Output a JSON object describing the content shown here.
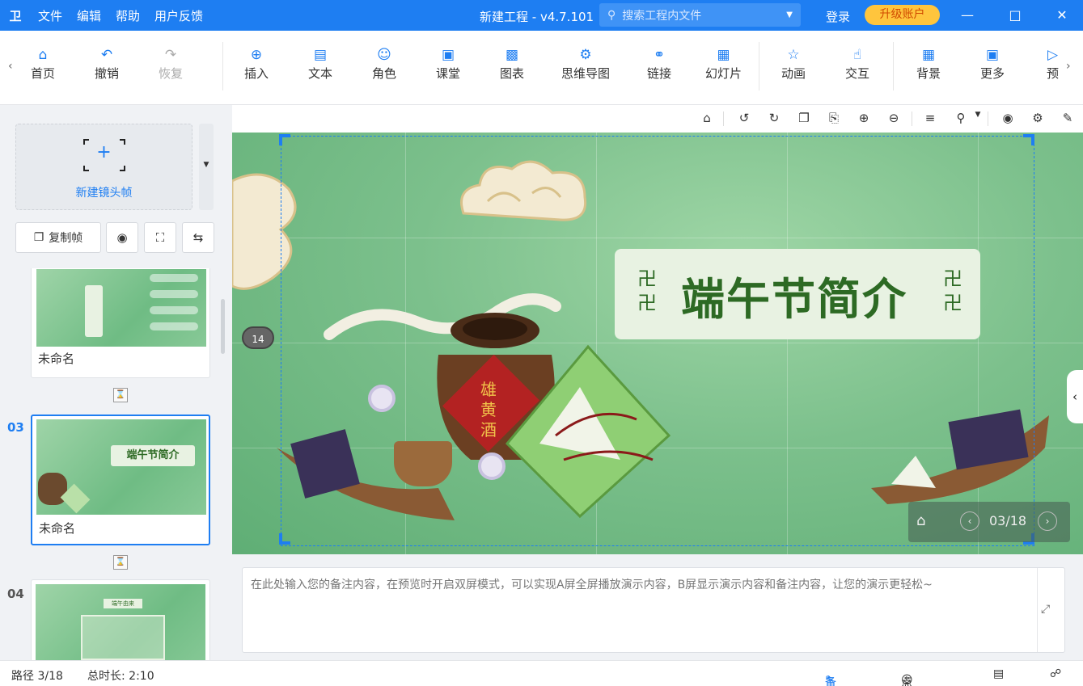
{
  "app": {
    "title": "新建工程 - v4.7.101",
    "logo": "卫",
    "menu": [
      "文件",
      "编辑",
      "帮助",
      "用户反馈"
    ],
    "search_placeholder": "搜索工程内文件",
    "login": "登录",
    "upgrade": "升级账户"
  },
  "toolbar": {
    "items": [
      {
        "label": "首页",
        "icon": "home-icon"
      },
      {
        "label": "撤销",
        "icon": "undo-icon"
      },
      {
        "label": "恢复",
        "icon": "redo-icon"
      },
      {
        "label": "插入",
        "icon": "plus-circle-icon"
      },
      {
        "label": "文本",
        "icon": "text-icon"
      },
      {
        "label": "角色",
        "icon": "person-icon"
      },
      {
        "label": "课堂",
        "icon": "classroom-icon"
      },
      {
        "label": "图表",
        "icon": "chart-icon"
      },
      {
        "label": "思维导图",
        "icon": "mindmap-icon"
      },
      {
        "label": "链接",
        "icon": "link-icon"
      },
      {
        "label": "幻灯片",
        "icon": "slideshow-icon"
      },
      {
        "label": "动画",
        "icon": "star-icon"
      },
      {
        "label": "交互",
        "icon": "pointer-icon"
      },
      {
        "label": "背景",
        "icon": "background-icon"
      },
      {
        "label": "更多",
        "icon": "grid-icon"
      },
      {
        "label": "预",
        "icon": "preview-icon"
      }
    ]
  },
  "left_panel": {
    "new_frame_label": "新建镜头帧",
    "copy_frame_label": "复制帧",
    "slides": [
      {
        "number": "",
        "name": "未命名"
      },
      {
        "number": "03",
        "name": "未命名",
        "thumb_title": "端午节简介"
      },
      {
        "number": "04",
        "name": "",
        "thumb_title": "端午由来"
      }
    ]
  },
  "canvas": {
    "slide_title": "端午节简介",
    "badge": "14",
    "page_counter": "03/18"
  },
  "notes": {
    "placeholder": "在此处输入您的备注内容，在预览时开启双屏模式，可以实现A屏全屏播放演示内容，B屏显示演示内容和备注内容，让您的演示更轻松~"
  },
  "status": {
    "path": "路径 3/18",
    "duration": "总时长: 2:10",
    "notes_label": "备注",
    "rollcall_label": "点名"
  },
  "colors": {
    "accent": "#1e7ef2",
    "upgrade": "#ffc53d",
    "title_green": "#2d6a24"
  }
}
